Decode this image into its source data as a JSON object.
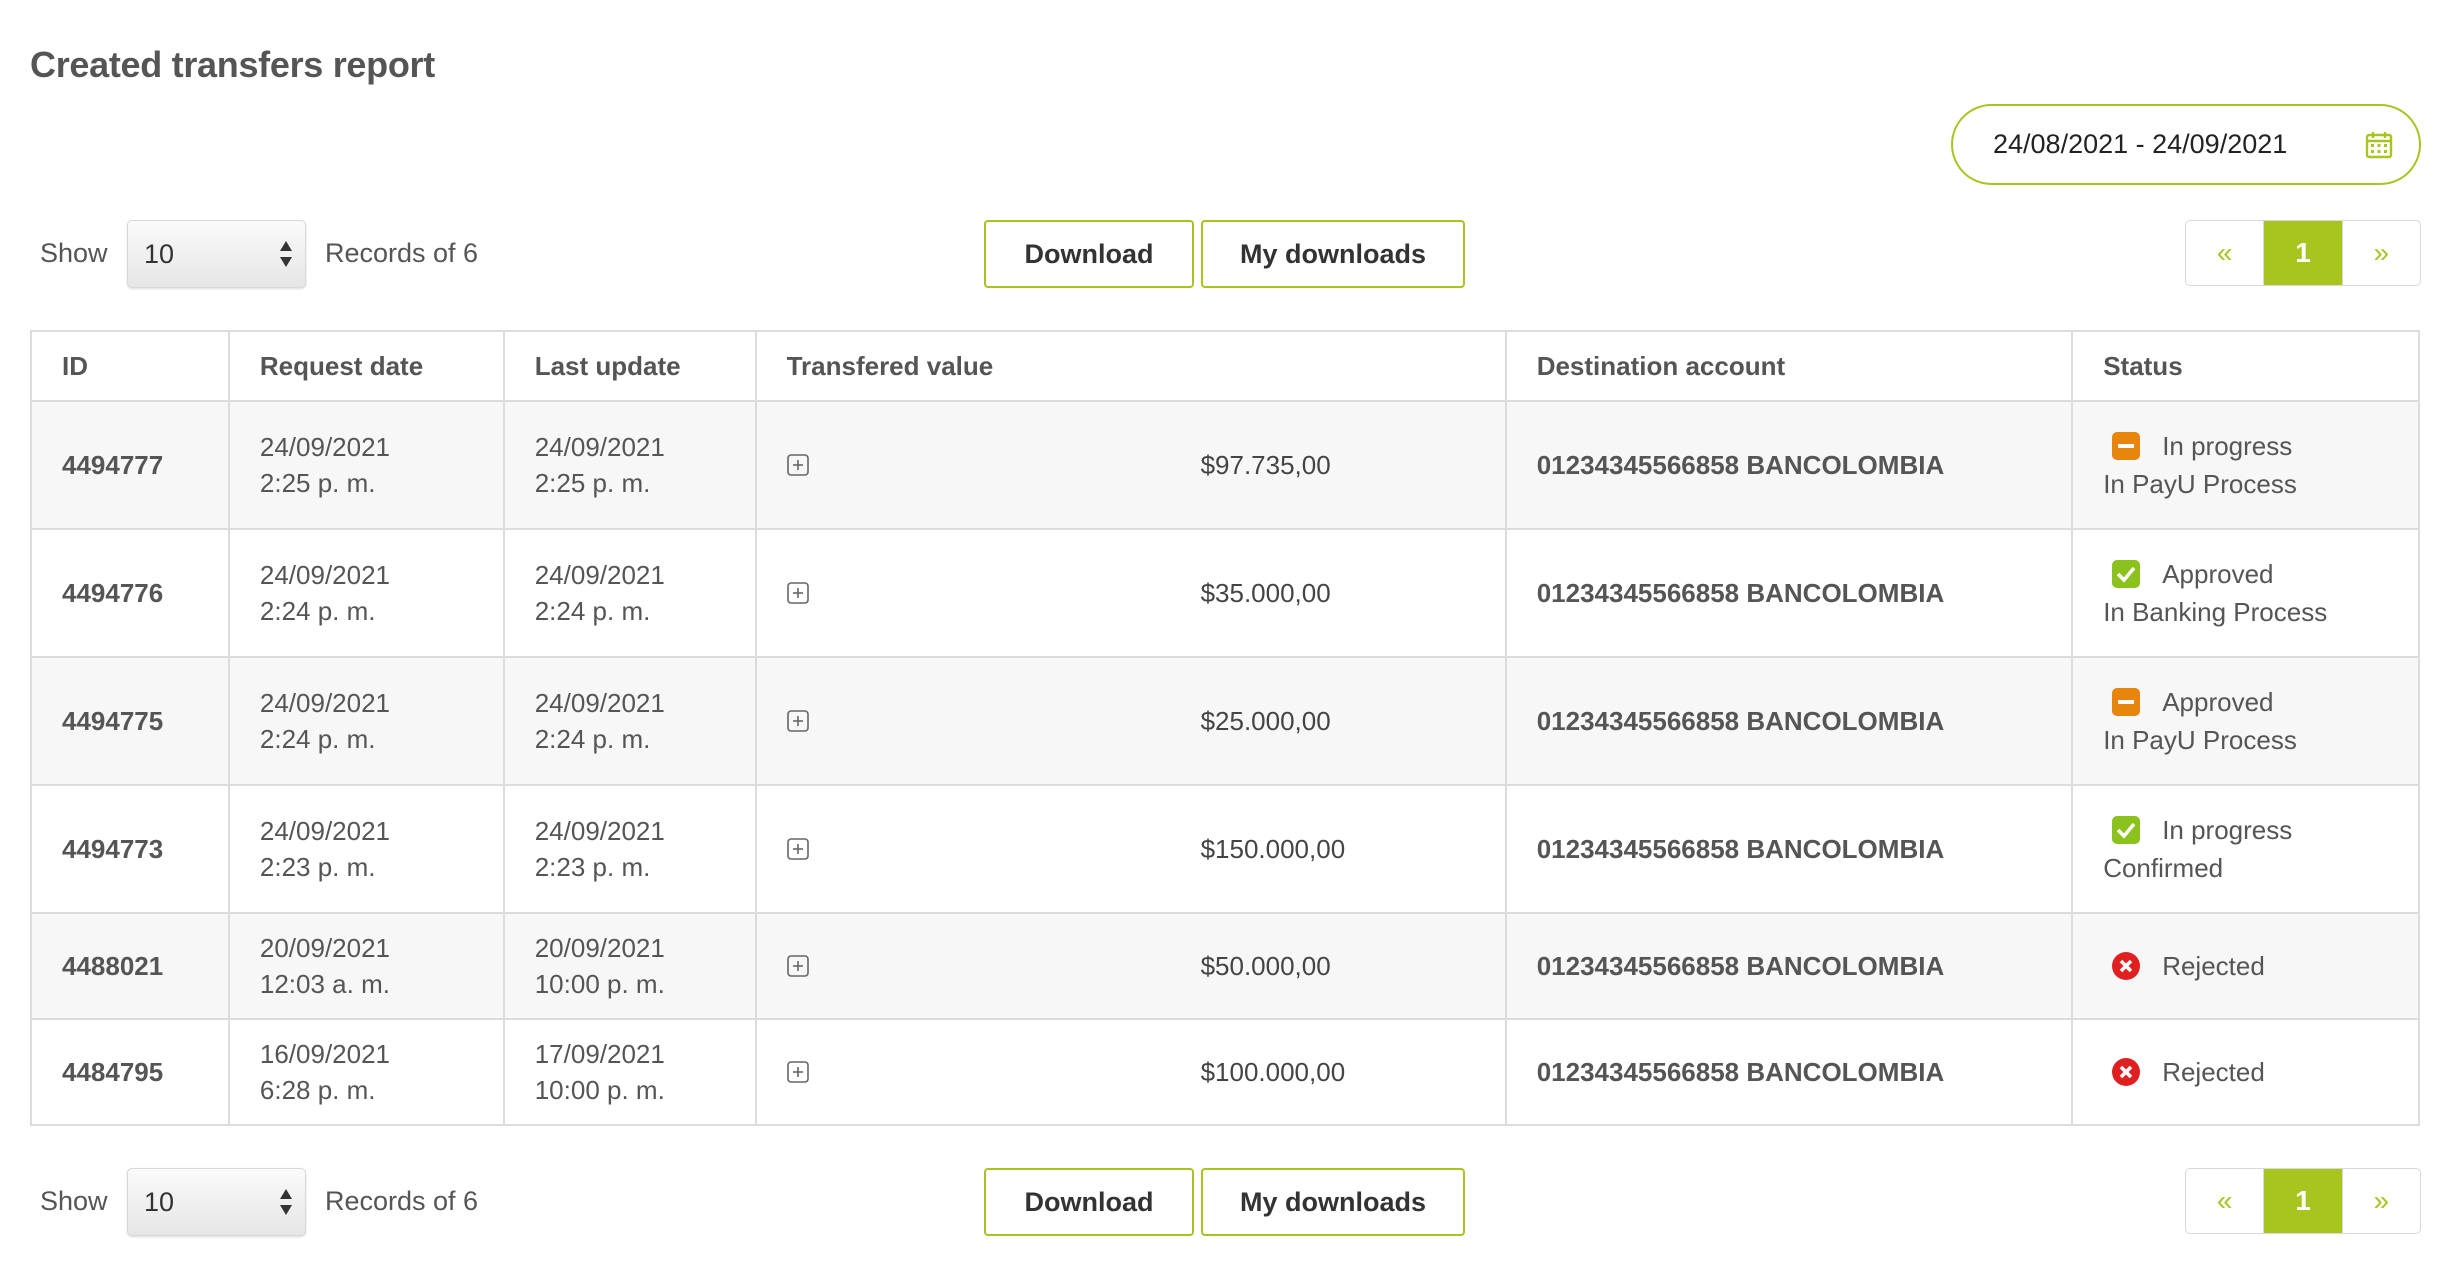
{
  "page": {
    "title": "Created transfers report"
  },
  "date_filter": {
    "range": "24/08/2021 - 24/09/2021",
    "icon": "calendar-icon"
  },
  "controls": {
    "show_label": "Show",
    "page_size": "10",
    "records_label": "Records of 6",
    "download_label": "Download",
    "my_downloads_label": "My downloads",
    "pager": {
      "prev": "«",
      "current": "1",
      "next": "»"
    }
  },
  "table": {
    "headers": {
      "id": "ID",
      "request_date": "Request date",
      "last_update": "Last update",
      "value": "Transfered value",
      "account": "Destination account",
      "status": "Status"
    },
    "rows": [
      {
        "id": "4494777",
        "req_date": "24/09/2021",
        "req_time": "2:25 p. m.",
        "upd_date": "24/09/2021",
        "upd_time": "2:25 p. m.",
        "amount": "$97.735,00",
        "account": "01234345566858 BANCOLOMBIA",
        "status": "In progress",
        "substatus": "In PayU Process",
        "icon": "orange-minus-icon"
      },
      {
        "id": "4494776",
        "req_date": "24/09/2021",
        "req_time": "2:24 p. m.",
        "upd_date": "24/09/2021",
        "upd_time": "2:24 p. m.",
        "amount": "$35.000,00",
        "account": "01234345566858 BANCOLOMBIA",
        "status": "Approved",
        "substatus": "In Banking Process",
        "icon": "green-check-icon"
      },
      {
        "id": "4494775",
        "req_date": "24/09/2021",
        "req_time": "2:24 p. m.",
        "upd_date": "24/09/2021",
        "upd_time": "2:24 p. m.",
        "amount": "$25.000,00",
        "account": "01234345566858 BANCOLOMBIA",
        "status": "Approved",
        "substatus": "In PayU Process",
        "icon": "orange-minus-icon"
      },
      {
        "id": "4494773",
        "req_date": "24/09/2021",
        "req_time": "2:23 p. m.",
        "upd_date": "24/09/2021",
        "upd_time": "2:23 p. m.",
        "amount": "$150.000,00",
        "account": "01234345566858 BANCOLOMBIA",
        "status": "In progress",
        "substatus": "Confirmed",
        "icon": "green-check-icon"
      },
      {
        "id": "4488021",
        "req_date": "20/09/2021",
        "req_time": "12:03 a. m.",
        "upd_date": "20/09/2021",
        "upd_time": "10:00 p. m.",
        "amount": "$50.000,00",
        "account": "01234345566858 BANCOLOMBIA",
        "status": "Rejected",
        "substatus": "",
        "icon": "red-x-icon"
      },
      {
        "id": "4484795",
        "req_date": "16/09/2021",
        "req_time": "6:28 p. m.",
        "upd_date": "17/09/2021",
        "upd_time": "10:00 p. m.",
        "amount": "$100.000,00",
        "account": "01234345566858 BANCOLOMBIA",
        "status": "Rejected",
        "substatus": "",
        "icon": "red-x-icon"
      }
    ]
  },
  "colors": {
    "accent": "#a8c41e",
    "warning": "#e8850c",
    "success": "#8cc21e",
    "danger": "#e02020"
  }
}
